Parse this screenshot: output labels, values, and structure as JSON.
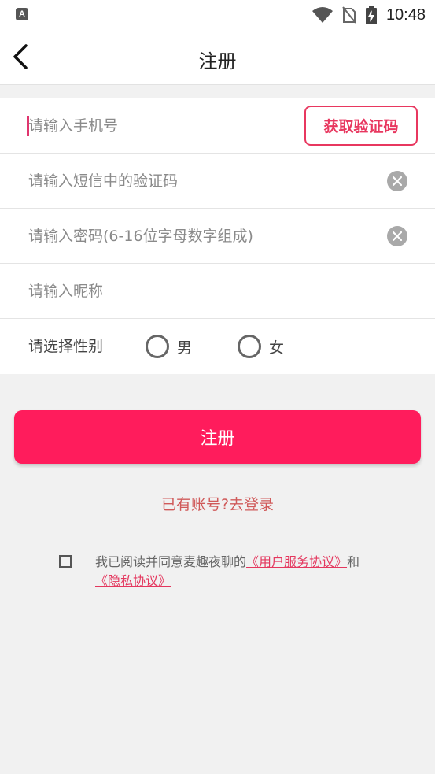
{
  "status_bar": {
    "app_icon_letter": "A",
    "time": "10:48"
  },
  "header": {
    "title": "注册"
  },
  "form": {
    "phone_placeholder": "请输入手机号",
    "get_code_label": "获取验证码",
    "sms_code_placeholder": "请输入短信中的验证码",
    "password_placeholder": "请输入密码(6-16位字母数字组成)",
    "nickname_placeholder": "请输入昵称",
    "gender_label": "请选择性别",
    "gender_options": [
      "男",
      "女"
    ]
  },
  "register_button_label": "注册",
  "login_link_label": "已有账号?去登录",
  "agreement": {
    "text_prefix": "我已阅读并同意麦趣夜聊的",
    "service_link": "《用户服务协议》",
    "connector": "和",
    "privacy_link": "《隐私协议》"
  },
  "colors": {
    "accent": "#ff1c5c",
    "link": "#e4375e",
    "login_link": "#d05a5a",
    "background": "#f1f1f1"
  },
  "icons": [
    "back-arrow-icon",
    "clear-icon",
    "wifi-icon",
    "no-sim-icon",
    "battery-charging-icon"
  ]
}
